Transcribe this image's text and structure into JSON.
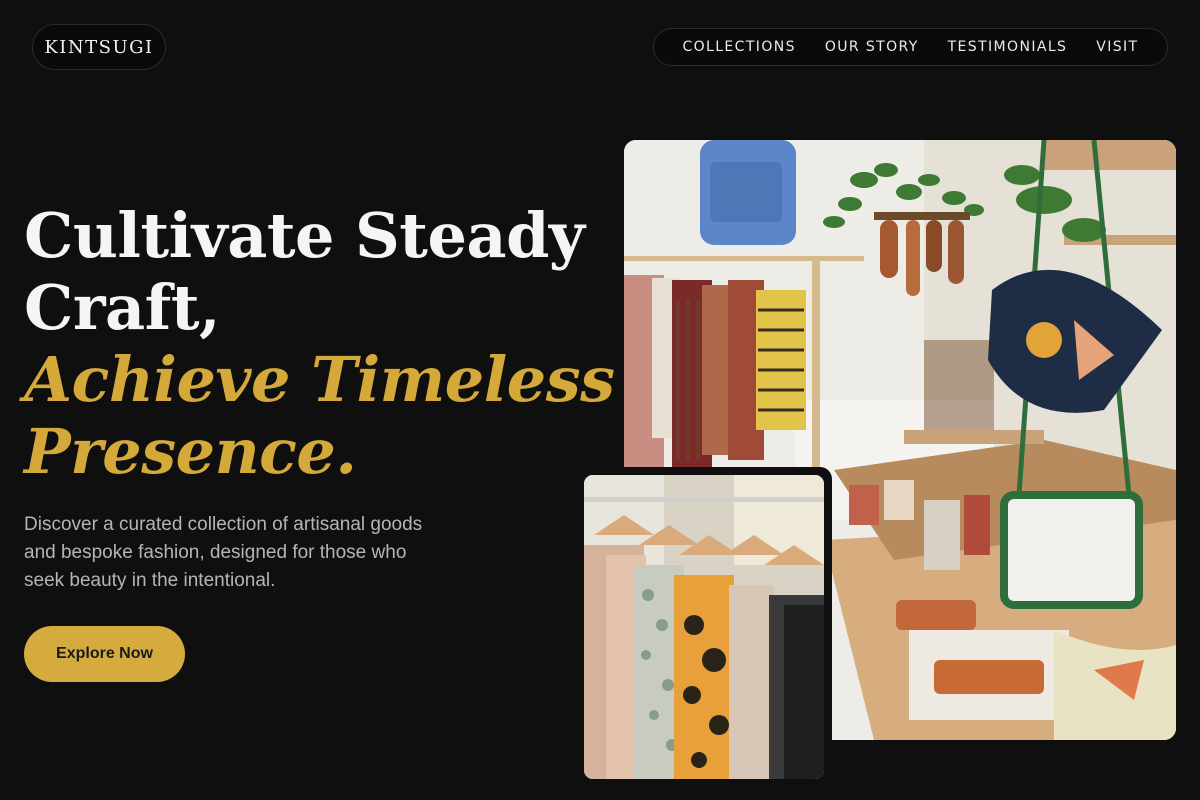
{
  "brand": {
    "name": "KINTSUGI"
  },
  "nav": {
    "items": [
      {
        "label": "COLLECTIONS"
      },
      {
        "label": "OUR STORY"
      },
      {
        "label": "TESTIMONIALS"
      },
      {
        "label": "VISIT"
      }
    ]
  },
  "hero": {
    "title_line1": "Cultivate Steady",
    "title_line2": "Craft,",
    "title_line3": "Achieve Timeless",
    "title_line4": "Presence.",
    "description": "Discover a curated collection of artisanal goods and bespoke fashion, designed for those who seek beauty in the intentional.",
    "cta_label": "Explore Now"
  },
  "images": {
    "main_alt": "Boutique interior with clothing racks, plants, handbags and leather goods on wooden table",
    "secondary_alt": "Clothing rack with patterned shirts on wooden hangers"
  },
  "colors": {
    "background": "#0f0f0f",
    "accent": "#d4a93a",
    "text_muted": "#b5b5b5"
  }
}
